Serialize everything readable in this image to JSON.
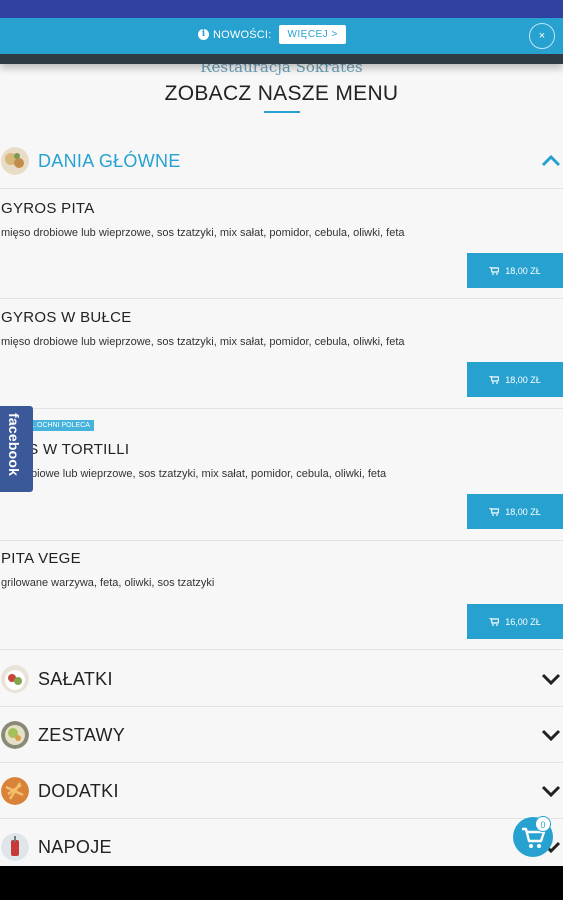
{
  "notice": {
    "text": "NOWOŚCI",
    "more_label": "WIĘCEJ >",
    "close_label": "×"
  },
  "header": {
    "restaurant": "Restauracja Sokrates",
    "title": "ZOBACZ NASZE MENU"
  },
  "sidebar_tab": {
    "label": "facebook"
  },
  "categories": [
    {
      "label": "DANIA GŁÓWNE",
      "icon": "gyros-thumbnail",
      "expanded": true
    },
    {
      "label": "SAŁATKI",
      "icon": "salad-thumbnail",
      "expanded": false
    },
    {
      "label": "ZESTAWY",
      "icon": "set-thumbnail",
      "expanded": false
    },
    {
      "label": "DODATKI",
      "icon": "sides-thumbnail",
      "expanded": false
    },
    {
      "label": "NAPOJE",
      "icon": "drinks-thumbnail",
      "expanded": false
    }
  ],
  "items": [
    {
      "name": "GYROS PITA",
      "desc": "mięso drobiowe lub wieprzowe, sos tzatzyki, mix sałat, pomidor, cebula, oliwki, feta",
      "price": "18,00 ZŁ"
    },
    {
      "name": "GYROS W BUŁCE",
      "desc": "mięso drobiowe lub wieprzowe, sos tzatzyki, mix sałat, pomidor, cebula, oliwki, feta",
      "price": "18,00 ZŁ"
    },
    {
      "name": "…OS W TORTILLI",
      "badge": "…OCHNI POLECA",
      "desc": "… drobiowe lub wieprzowe, sos tzatzyki, mix sałat, pomidor, cebula, oliwki, feta",
      "price": "18,00 ZŁ"
    },
    {
      "name": "PITA VEGE",
      "desc": "grilowane warzywa, feta, oliwki, sos tzatzyki",
      "price": "16,00 ZŁ"
    }
  ],
  "cart": {
    "count": "0",
    "icon": "cart-icon"
  },
  "colors": {
    "accent": "#27a2d0",
    "top": "#3040a0",
    "facebook": "#3b5998"
  }
}
